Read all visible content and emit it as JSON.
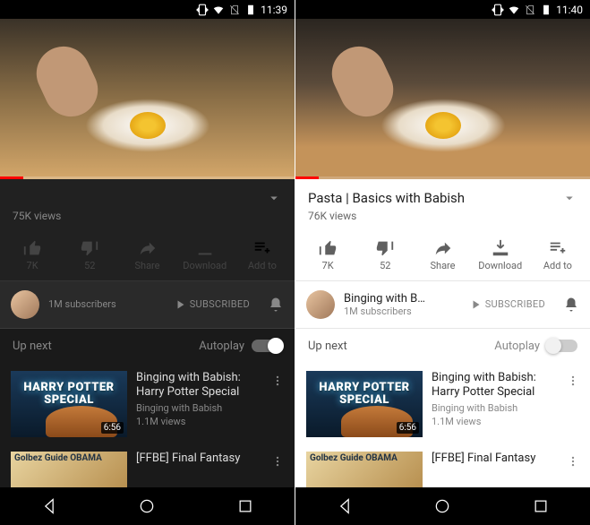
{
  "left": {
    "statusTime": "11:39",
    "views": "75K views",
    "actions": {
      "like": "7K",
      "dislike": "52",
      "share": "Share",
      "download": "Download",
      "addto": "Add to"
    },
    "subscribers": "1M subscribers",
    "subscribedLabel": "SUBSCRIBED",
    "upNext": "Up next",
    "autoplay": "Autoplay",
    "items": [
      {
        "title": "Binging with Babish: Harry Potter Special",
        "channel": "Binging with Babish",
        "views": "1.1M views",
        "duration": "6:56",
        "thumbText": "HARRY POTTER\nSPECIAL"
      },
      {
        "title": "[FFBE] Final Fantasy",
        "channel": "",
        "views": "",
        "duration": "",
        "thumbText": "Golbez Guide OBAMA"
      }
    ]
  },
  "right": {
    "statusTime": "11:40",
    "title": "Pasta | Basics with Babish",
    "views": "76K views",
    "actions": {
      "like": "7K",
      "dislike": "52",
      "share": "Share",
      "download": "Download",
      "addto": "Add to"
    },
    "channelName": "Binging with B…",
    "subscribers": "1M subscribers",
    "subscribedLabel": "SUBSCRIBED",
    "upNext": "Up next",
    "autoplay": "Autoplay",
    "items": [
      {
        "title": "Binging with Babish: Harry Potter Special",
        "channel": "Binging with Babish",
        "views": "1.1M views",
        "duration": "6:56",
        "thumbText": "HARRY POTTER\nSPECIAL"
      },
      {
        "title": "[FFBE] Final Fantasy",
        "channel": "",
        "views": "",
        "duration": "",
        "thumbText": "Golbez Guide OBAMA"
      }
    ]
  }
}
